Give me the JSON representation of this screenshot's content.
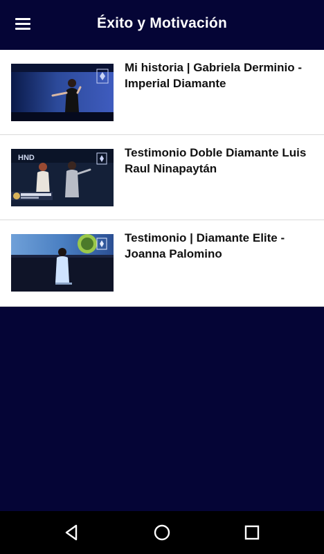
{
  "appbar": {
    "title": "Éxito y Motivación",
    "menu_icon": "hamburger-menu-icon"
  },
  "videos": [
    {
      "title": "Mi historia | Gabriela Derminio - Imperial Diamante",
      "thumbnail": "speaker-on-stage-thumbnail"
    },
    {
      "title": "Testimonio Doble Diamante Luis Raul Ninapaytán",
      "thumbnail": "couple-on-stage-thumbnail",
      "thumb_text": "HND"
    },
    {
      "title": "Testimonio | Diamante Elite - Joanna Palomino",
      "thumbnail": "woman-on-stage-thumbnail"
    }
  ],
  "navbar": {
    "back_icon": "back-triangle-icon",
    "home_icon": "home-circle-icon",
    "recents_icon": "recents-square-icon"
  },
  "colors": {
    "primary": "#050536",
    "surface": "#ffffff",
    "text": "#111111",
    "navbar": "#000000"
  }
}
